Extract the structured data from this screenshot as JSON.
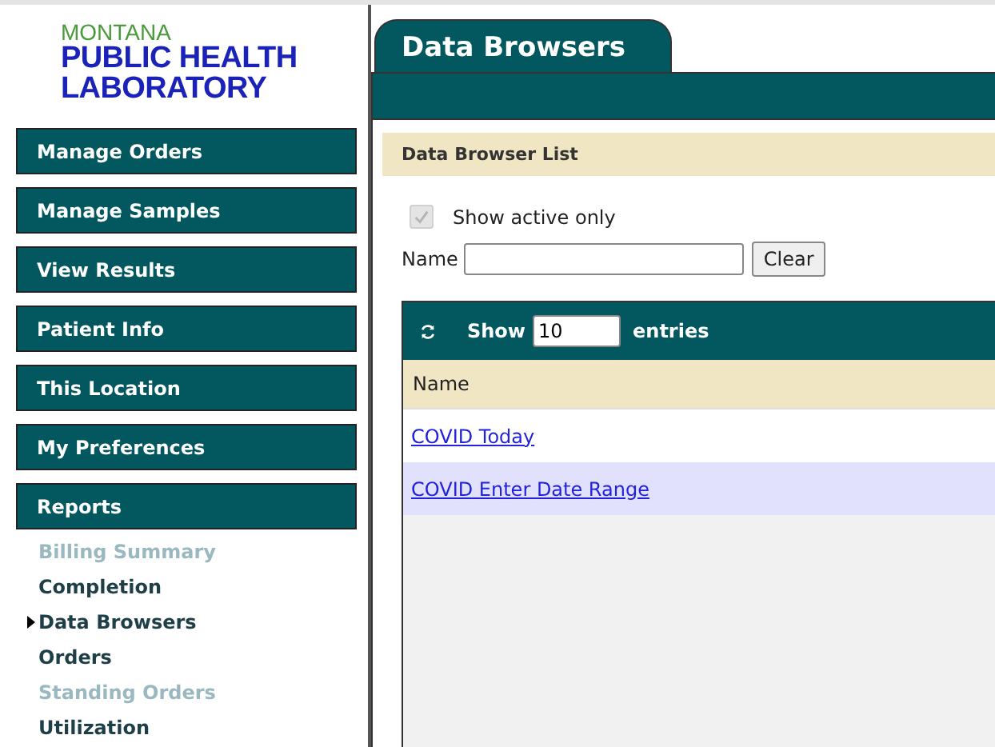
{
  "logo": {
    "line_1": "MONTANA",
    "line_2": "PUBLIC HEALTH",
    "line_3": "LABORATORY"
  },
  "nav": [
    {
      "label": "Manage Orders"
    },
    {
      "label": "Manage Samples"
    },
    {
      "label": "View Results"
    },
    {
      "label": "Patient Info"
    },
    {
      "label": "This Location"
    },
    {
      "label": "My Preferences"
    },
    {
      "label": "Reports"
    }
  ],
  "submenu": [
    {
      "label": "Billing Summary",
      "disabled": true,
      "selected": false
    },
    {
      "label": "Completion",
      "disabled": false,
      "selected": false
    },
    {
      "label": "Data Browsers",
      "disabled": false,
      "selected": true
    },
    {
      "label": "Orders",
      "disabled": false,
      "selected": false
    },
    {
      "label": "Standing Orders",
      "disabled": true,
      "selected": false
    },
    {
      "label": "Utilization",
      "disabled": false,
      "selected": false
    }
  ],
  "tab": {
    "label": "Data Browsers"
  },
  "section": {
    "title": "Data Browser List"
  },
  "filter": {
    "checkbox_label": "Show active only",
    "checked": true,
    "disabled": true,
    "name_label": "Name",
    "clear_button": "Clear"
  },
  "table": {
    "show_label": "Show",
    "page_size": "10",
    "entries_label": "entries",
    "columns": [
      "Name"
    ],
    "rows": [
      {
        "name": "COVID Today",
        "selected": false
      },
      {
        "name": "COVID Enter Date Range",
        "selected": true
      }
    ]
  }
}
